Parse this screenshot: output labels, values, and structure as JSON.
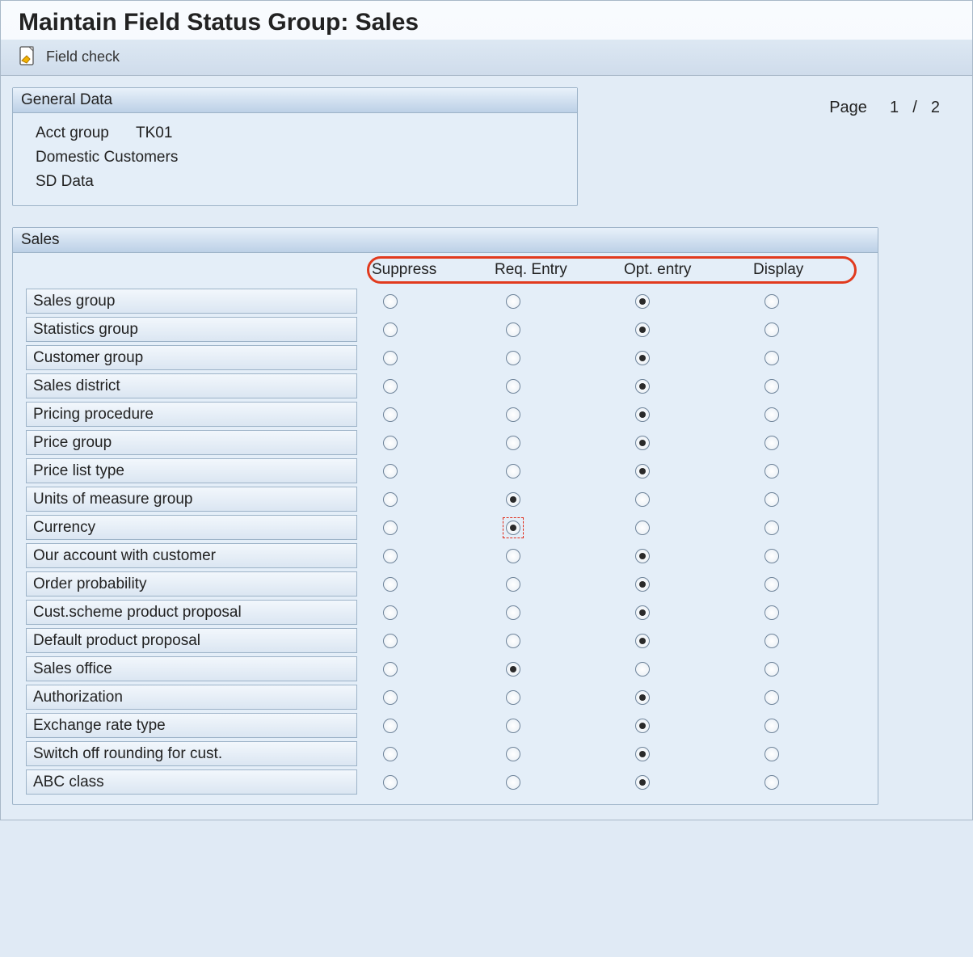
{
  "title": "Maintain Field Status Group: Sales",
  "toolbar": {
    "field_check": "Field check"
  },
  "general_data": {
    "header": "General Data",
    "acct_group_label": "Acct group",
    "acct_group_value": "TK01",
    "line2": "Domestic Customers",
    "line3": "SD Data"
  },
  "pager": {
    "label": "Page",
    "current": "1",
    "sep": "/",
    "total": "2"
  },
  "sales": {
    "header": "Sales",
    "columns": [
      "Suppress",
      "Req. Entry",
      "Opt. entry",
      "Display"
    ],
    "rows": [
      {
        "label": "Sales group",
        "selected": 2,
        "focus": false
      },
      {
        "label": "Statistics group",
        "selected": 2,
        "focus": false
      },
      {
        "label": "Customer group",
        "selected": 2,
        "focus": false
      },
      {
        "label": "Sales district",
        "selected": 2,
        "focus": false
      },
      {
        "label": "Pricing procedure",
        "selected": 2,
        "focus": false
      },
      {
        "label": "Price group",
        "selected": 2,
        "focus": false
      },
      {
        "label": "Price list type",
        "selected": 2,
        "focus": false
      },
      {
        "label": "Units of measure group",
        "selected": 1,
        "focus": false
      },
      {
        "label": "Currency",
        "selected": 1,
        "focus": true
      },
      {
        "label": "Our account with customer",
        "selected": 2,
        "focus": false
      },
      {
        "label": "Order probability",
        "selected": 2,
        "focus": false
      },
      {
        "label": "Cust.scheme product proposal",
        "selected": 2,
        "focus": false
      },
      {
        "label": "Default product proposal",
        "selected": 2,
        "focus": false
      },
      {
        "label": "Sales office",
        "selected": 1,
        "focus": false
      },
      {
        "label": "Authorization",
        "selected": 2,
        "focus": false
      },
      {
        "label": "Exchange rate type",
        "selected": 2,
        "focus": false
      },
      {
        "label": "Switch off rounding for cust.",
        "selected": 2,
        "focus": false
      },
      {
        "label": "ABC class",
        "selected": 2,
        "focus": false
      }
    ]
  }
}
